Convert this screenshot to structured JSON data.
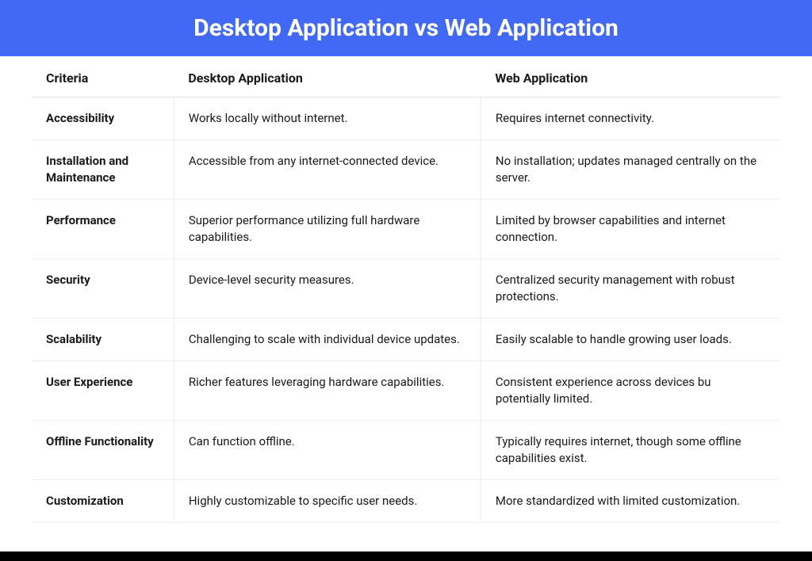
{
  "title": "Desktop Application vs Web Application",
  "columns": {
    "criteria": "Criteria",
    "desktop": "Desktop Application",
    "web": "Web Application"
  },
  "rows": [
    {
      "criteria": "Accessibility",
      "desktop": "Works locally without internet.",
      "web": "Requires internet connectivity."
    },
    {
      "criteria": "Installation and Maintenance",
      "desktop": "Accessible from any internet-connected device.",
      "web": "No installation; updates managed centrally on the server."
    },
    {
      "criteria": "Performance",
      "desktop": "Superior performance utilizing full hardware capabilities.",
      "web": "Limited by browser capabilities and internet connection."
    },
    {
      "criteria": "Security",
      "desktop": "Device-level security measures.",
      "web": "Centralized security management with robust protections."
    },
    {
      "criteria": "Scalability",
      "desktop": "Challenging to scale with individual device updates.",
      "web": "Easily scalable to handle growing user loads."
    },
    {
      "criteria": "User Experience",
      "desktop": "Richer features leveraging hardware capabilities.",
      "web": "Consistent experience across devices bu potentially limited."
    },
    {
      "criteria": "Offline Functionality",
      "desktop": "Can function offline.",
      "web": "Typically requires internet, though some offline capabilities exist."
    },
    {
      "criteria": "Customization",
      "desktop": "Highly customizable to specific user needs.",
      "web": "More standardized with limited customization."
    }
  ]
}
